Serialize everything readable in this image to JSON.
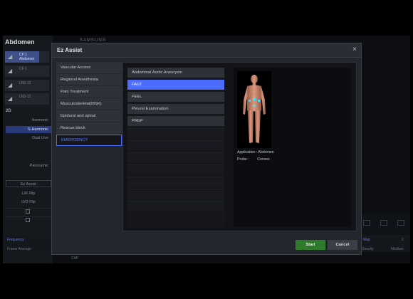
{
  "background": {
    "title": "Abdomen",
    "brand": "SAMSUNG",
    "probes": [
      {
        "name": "CF 1",
        "sub": "Abdomen",
        "active": true
      },
      {
        "name": "CF 1",
        "sub": "",
        "active": false
      },
      {
        "name": "LN5-12",
        "sub": "",
        "active": false
      },
      {
        "name": "LN5-12",
        "sub": "",
        "active": false
      }
    ],
    "section": "2D",
    "modes": [
      "Harmonic",
      "S-Harmonic",
      "Dual Live",
      "Panoramic",
      "Ez Assist",
      "L/R Flip",
      "U/D Flip"
    ],
    "bottom": {
      "frequency": "Frequency",
      "frame_average": "Frame Average",
      "cap": "CAP",
      "density": "Density",
      "medium": "Medium",
      "map_label": "Map",
      "map_value": "2"
    }
  },
  "dialog": {
    "title": "Ez Assist",
    "close": "×",
    "categories": [
      {
        "label": "Vascular Access",
        "active": false
      },
      {
        "label": "Regional Anesthesia",
        "active": false
      },
      {
        "label": "Pain Treatment",
        "active": false
      },
      {
        "label": "Musculoskeletal(MSK)",
        "active": false
      },
      {
        "label": "Epidural and spinal",
        "active": false
      },
      {
        "label": "Rescue block",
        "active": false
      },
      {
        "label": "EMERGENCY",
        "active": true
      }
    ],
    "presets": [
      {
        "label": "Abdominal Aortic Aneurysm",
        "active": false
      },
      {
        "label": "FAST",
        "active": true
      },
      {
        "label": "FEEL",
        "active": false
      },
      {
        "label": "Pleural Examination",
        "active": false
      },
      {
        "label": "PREP",
        "active": false
      }
    ],
    "application_label": "Application :",
    "application_value": "Abdomen",
    "probe_label": "Probe :",
    "probe_value": "Convex",
    "start_label": "Start",
    "cancel_label": "Cancel"
  }
}
